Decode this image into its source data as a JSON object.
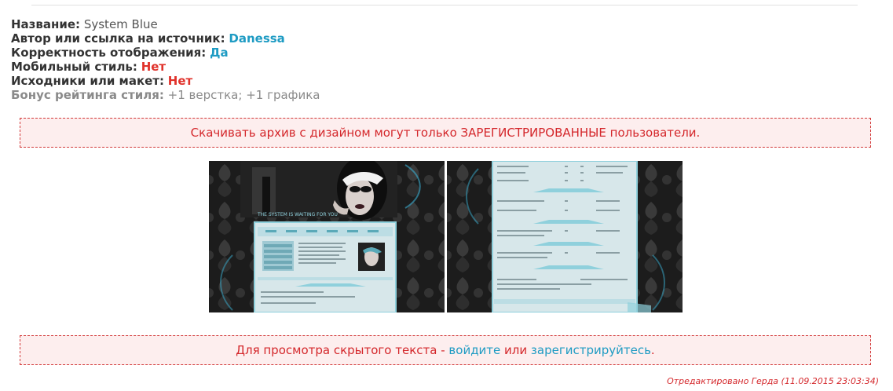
{
  "info": {
    "name_label": "Название:",
    "name_value": "System Blue",
    "author_label": "Автор или ссылка на источник:",
    "author_value": "Danessa",
    "display_label": "Корректность отображения:",
    "display_value": "Да",
    "mobile_label": "Мобильный стиль:",
    "mobile_value": "Нет",
    "sources_label": "Исходники или макет:",
    "sources_value": "Нет",
    "bonus_label": "Бонус рейтинга стиля:",
    "bonus_value": "+1 верстка; +1 графика"
  },
  "notice_download": "Скачивать архив с дизайном могут только ЗАРЕГИСТРИРОВАННЫЕ пользователи.",
  "hidden_notice": {
    "prefix": "Для просмотра скрытого текста - ",
    "login_link": "войдите",
    "middle": " или ",
    "register_link": "зарегистрируйтесь",
    "suffix": "."
  },
  "screenshot1": {
    "banner_text": "THE SYSTEM IS WAITING FOR YOU"
  },
  "edited_note": "Отредактировано Герда (11.09.2015 23:03:34)",
  "colors": {
    "accent": "#1e9bc3",
    "alert": "#d4272b",
    "theme": "#8fd0dc"
  }
}
